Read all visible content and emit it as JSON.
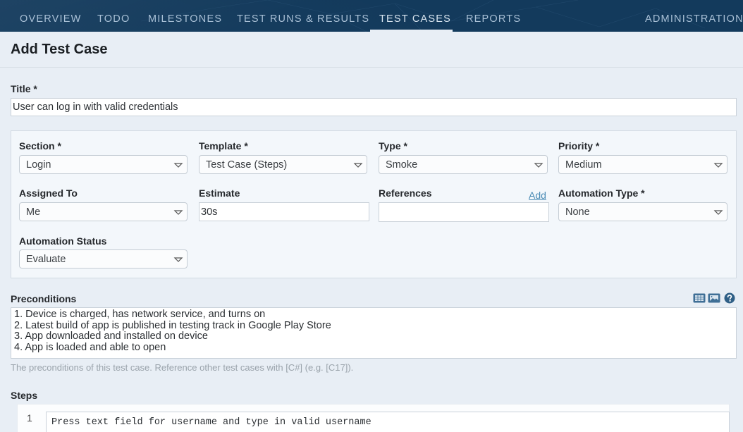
{
  "nav": {
    "items": [
      {
        "label": "OVERVIEW"
      },
      {
        "label": "TODO"
      },
      {
        "label": "MILESTONES"
      },
      {
        "label": "TEST RUNS & RESULTS"
      },
      {
        "label": "TEST CASES",
        "active": true
      },
      {
        "label": "REPORTS"
      }
    ],
    "admin": "ADMINISTRATION"
  },
  "page": {
    "title": "Add Test Case"
  },
  "form": {
    "title": {
      "label": "Title *",
      "value": "User can log in with valid credentials"
    },
    "section": {
      "label": "Section *",
      "value": "Login"
    },
    "template": {
      "label": "Template *",
      "value": "Test Case (Steps)"
    },
    "type": {
      "label": "Type *",
      "value": "Smoke"
    },
    "priority": {
      "label": "Priority *",
      "value": "Medium"
    },
    "assigned_to": {
      "label": "Assigned To",
      "value": "Me"
    },
    "estimate": {
      "label": "Estimate",
      "value": "30s"
    },
    "references": {
      "label": "References",
      "value": "",
      "add_link": "Add"
    },
    "automation_type": {
      "label": "Automation Type *",
      "value": "None"
    },
    "automation_status": {
      "label": "Automation Status",
      "value": "Evaluate"
    },
    "preconditions": {
      "label": "Preconditions",
      "lines": [
        "1. Device is charged, has network service, and turns on",
        "2. Latest build of app is published in testing track in Google Play Store",
        "3. App downloaded and installed on device",
        "4. App is loaded and able to open"
      ],
      "hint": "The preconditions of this test case. Reference other test cases with [C#] (e.g. [C17]).",
      "toolbar_icons": [
        "table-icon",
        "image-icon",
        "help-icon"
      ]
    },
    "steps": {
      "label": "Steps",
      "items": [
        {
          "number": "1",
          "content": "Press text field for username and type in valid username"
        }
      ]
    }
  },
  "colors": {
    "nav_bg": "#133a5c",
    "nav_text": "#a9c0d6",
    "page_bg": "#e8eef5",
    "link": "#4a8bb5",
    "icon": "#3f6f96"
  }
}
